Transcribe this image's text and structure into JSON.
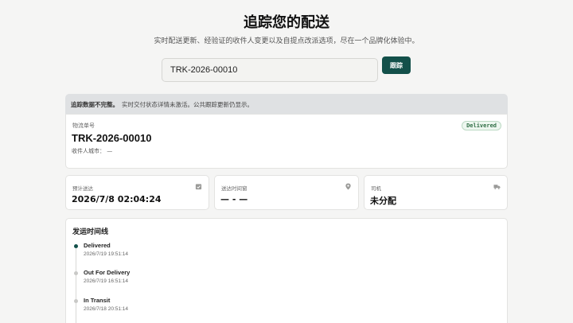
{
  "header": {
    "title": "追踪您的配送",
    "subtitle": "实时配送更新、经验证的收件人变更以及自提点改派选项，尽在一个品牌化体验中。"
  },
  "search": {
    "value": "TRK-2026-00010",
    "button_label": "跟踪"
  },
  "notice": {
    "bold": "追踪数据不完整。",
    "text": "实时交付状态详情未激活。公共跟踪更新仍显示。"
  },
  "shipment": {
    "tracking_label": "物流单号",
    "tracking_number": "TRK-2026-00010",
    "status_badge": "Delivered",
    "city_label": "收件人城市：",
    "city_value": "—"
  },
  "info_cards": [
    {
      "label": "预计送达",
      "value": "2026/7/8 02:04:24",
      "icon": "calendar-check-icon"
    },
    {
      "label": "送达时间窗",
      "value": "— - —",
      "icon": "map-pin-icon"
    },
    {
      "label": "司机",
      "value": "未分配",
      "icon": "truck-icon"
    }
  ],
  "timeline": {
    "title": "发运时间线",
    "events": [
      {
        "status": "Delivered",
        "time": "2026/7/19 19:51:14",
        "active": true
      },
      {
        "status": "Out For Delivery",
        "time": "2026/7/19 16:51:14",
        "active": false
      },
      {
        "status": "In Transit",
        "time": "2026/7/18 20:51:14",
        "active": false
      }
    ]
  },
  "colors": {
    "accent": "#13504a",
    "delivered_badge_text": "#2f6e45",
    "notice_bg": "#dfe1e3"
  }
}
